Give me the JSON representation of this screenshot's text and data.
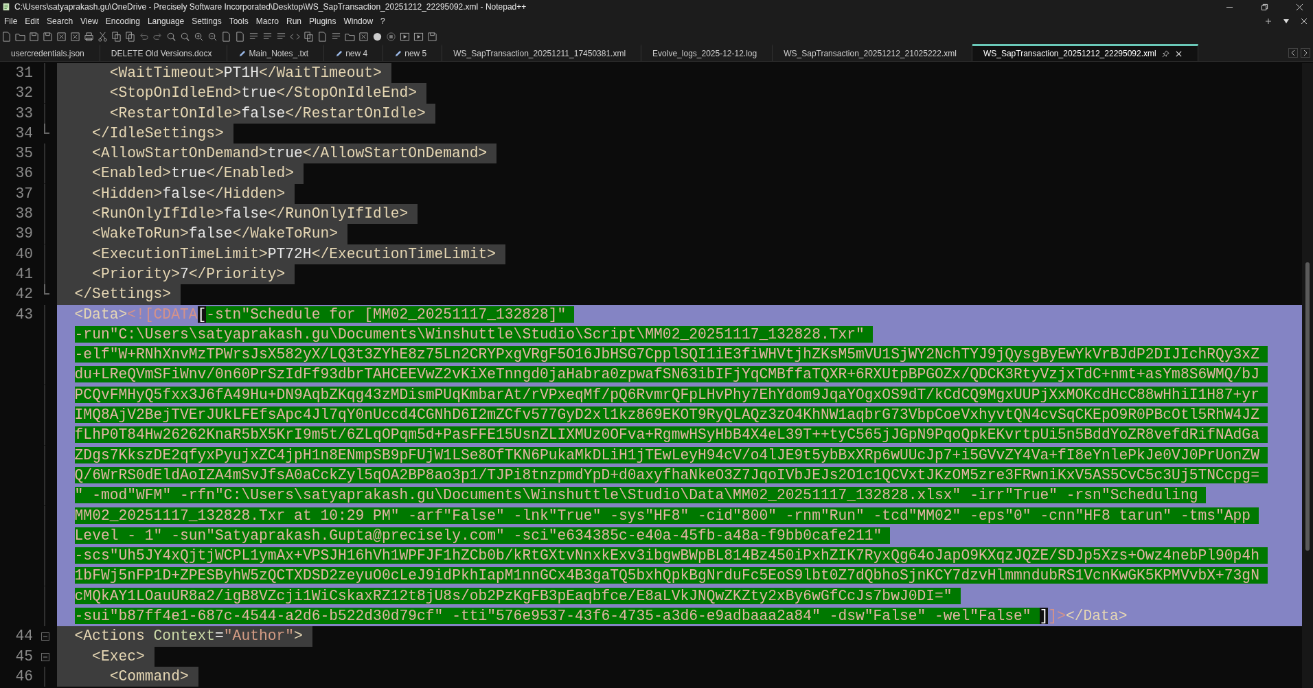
{
  "window": {
    "title": "C:\\Users\\satyaprakash.gu\\OneDrive - Precisely Software Incorporated\\Desktop\\WS_SapTransaction_20251212_22295092.xml - Notepad++"
  },
  "menu": [
    "File",
    "Edit",
    "Search",
    "View",
    "Encoding",
    "Language",
    "Settings",
    "Tools",
    "Macro",
    "Run",
    "Plugins",
    "Window",
    "?"
  ],
  "tabs": [
    {
      "label": "usercredentials.json",
      "modified": false,
      "selected": false
    },
    {
      "label": "DELETE Old Versions.docx",
      "modified": false,
      "selected": false
    },
    {
      "label": "Main_Notes_.txt",
      "modified": true,
      "selected": false
    },
    {
      "label": "new 4",
      "modified": true,
      "selected": false
    },
    {
      "label": "new 5",
      "modified": true,
      "selected": false
    },
    {
      "label": "WS_SapTransaction_20251211_17450381.xml",
      "modified": false,
      "selected": false
    },
    {
      "label": "Evolve_logs_2025-12-12.log",
      "modified": false,
      "selected": false
    },
    {
      "label": "WS_SapTransaction_20251212_21025222.xml",
      "modified": false,
      "selected": false
    },
    {
      "label": "WS_SapTransaction_20251212_22295092.xml",
      "modified": false,
      "selected": true
    }
  ],
  "editor": {
    "lines": [
      {
        "number": "31",
        "fold_open": false,
        "fold_end": false,
        "selected": false,
        "tokens": [
          {
            "kind": "tag",
            "text": "      <WaitTimeout>"
          },
          {
            "kind": "text",
            "text": "PT1H"
          },
          {
            "kind": "tag",
            "text": "</WaitTimeout>"
          }
        ]
      },
      {
        "number": "32",
        "fold_open": false,
        "fold_end": false,
        "selected": false,
        "tokens": [
          {
            "kind": "tag",
            "text": "      <StopOnIdleEnd>"
          },
          {
            "kind": "text",
            "text": "true"
          },
          {
            "kind": "tag",
            "text": "</StopOnIdleEnd>"
          }
        ]
      },
      {
        "number": "33",
        "fold_open": false,
        "fold_end": false,
        "selected": false,
        "tokens": [
          {
            "kind": "tag",
            "text": "      <RestartOnIdle>"
          },
          {
            "kind": "text",
            "text": "false"
          },
          {
            "kind": "tag",
            "text": "</RestartOnIdle>"
          }
        ]
      },
      {
        "number": "34",
        "fold_open": false,
        "fold_end": true,
        "selected": false,
        "tokens": [
          {
            "kind": "tag",
            "text": "    </IdleSettings>"
          }
        ]
      },
      {
        "number": "35",
        "fold_open": false,
        "fold_end": false,
        "selected": false,
        "tokens": [
          {
            "kind": "tag",
            "text": "    <AllowStartOnDemand>"
          },
          {
            "kind": "text",
            "text": "true"
          },
          {
            "kind": "tag",
            "text": "</AllowStartOnDemand>"
          }
        ]
      },
      {
        "number": "36",
        "fold_open": false,
        "fold_end": false,
        "selected": false,
        "tokens": [
          {
            "kind": "tag",
            "text": "    <Enabled>"
          },
          {
            "kind": "text",
            "text": "true"
          },
          {
            "kind": "tag",
            "text": "</Enabled>"
          }
        ]
      },
      {
        "number": "37",
        "fold_open": false,
        "fold_end": false,
        "selected": false,
        "tokens": [
          {
            "kind": "tag",
            "text": "    <Hidden>"
          },
          {
            "kind": "text",
            "text": "false"
          },
          {
            "kind": "tag",
            "text": "</Hidden>"
          }
        ]
      },
      {
        "number": "38",
        "fold_open": false,
        "fold_end": false,
        "selected": false,
        "tokens": [
          {
            "kind": "tag",
            "text": "    <RunOnlyIfIdle>"
          },
          {
            "kind": "text",
            "text": "false"
          },
          {
            "kind": "tag",
            "text": "</RunOnlyIfIdle>"
          }
        ]
      },
      {
        "number": "39",
        "fold_open": false,
        "fold_end": false,
        "selected": false,
        "tokens": [
          {
            "kind": "tag",
            "text": "    <WakeToRun>"
          },
          {
            "kind": "text",
            "text": "false"
          },
          {
            "kind": "tag",
            "text": "</WakeToRun>"
          }
        ]
      },
      {
        "number": "40",
        "fold_open": false,
        "fold_end": false,
        "selected": false,
        "tokens": [
          {
            "kind": "tag",
            "text": "    <ExecutionTimeLimit>"
          },
          {
            "kind": "text",
            "text": "PT72H"
          },
          {
            "kind": "tag",
            "text": "</ExecutionTimeLimit>"
          }
        ]
      },
      {
        "number": "41",
        "fold_open": false,
        "fold_end": false,
        "selected": false,
        "tokens": [
          {
            "kind": "tag",
            "text": "    <Priority>"
          },
          {
            "kind": "text",
            "text": "7"
          },
          {
            "kind": "tag",
            "text": "</Priority>"
          }
        ]
      },
      {
        "number": "42",
        "fold_open": false,
        "fold_end": true,
        "selected": false,
        "tokens": [
          {
            "kind": "tag",
            "text": "  </Settings>"
          }
        ]
      },
      {
        "number": "43",
        "fold_open": false,
        "fold_end": false,
        "selected": true,
        "tokens": [
          {
            "kind": "tag",
            "text": "  <Data>"
          },
          {
            "kind": "cdata",
            "text": "<![CDATA"
          },
          {
            "kind": "brace",
            "text": "["
          },
          {
            "kind": "match",
            "text": "-stn\"Schedule for [MM02_20251117_132828]\""
          },
          {
            "kind": "wrap"
          },
          {
            "kind": "match",
            "text": "-run\"C:\\Users\\satyaprakash.gu\\Documents\\Winshuttle\\Studio\\Script\\MM02_20251117_132828.Txr\""
          },
          {
            "kind": "wrap"
          },
          {
            "kind": "match",
            "text": "-elf\"W+RNhXnvMzTPWrsJsX582yX/LQ3t3ZYhE8z75Ln2CRYPxgVRgF5O16JbHSG7CpplSQI1iE3fiWHVtjhZKsM5mVU1SjWY2NchTYJ9jQysgByEwYkVrBJdP2DIJIchRQy3xZ"
          },
          {
            "kind": "wrap"
          },
          {
            "kind": "match",
            "text": "du+LReQVmSFiWnv/0n60PrSzIdFf93dbrTAHCEEVwZ2vKiXeTnngd0jaHabra0zpwafSN63ibIFjYqCMBffaTQXR+6RXUtpBPGOZx/QDCK3RtyVzjxTdC+nmt+asYm8S6WMQ/bJ"
          },
          {
            "kind": "wrap"
          },
          {
            "kind": "match",
            "text": "PCQvFMHyQ5fxx3J6fA49Hu+DN9AqbZKqg43zMDismPUqKmbarAt/rVPxeqMf/pQ6RvmrQFpLHvPhy7EhYdom9JqaYOgxOS9dT/kCdCQ9MgxUUPjXxMOKcdHcC88wHhiI1H87+yr"
          },
          {
            "kind": "wrap"
          },
          {
            "kind": "match",
            "text": "IMQ8AjV2BejTVErJUkLFEfsApc4Jl7qY0nUccd4CGNhD6I2mZCfv577GyD2xl1kz869EKOT9RyQLAQz3zO4KhNW1aqbrG73VbpCoeVxhyvtQN4cvSqCKEpO9R0PBcOtl5RhW4JZ"
          },
          {
            "kind": "wrap"
          },
          {
            "kind": "match",
            "text": "fLhP0T84Hw26262KnaR5bX5KrI9m5t/6ZLqOPqm5d+PasFFE15UsnZLIXMUz0OFva+RgmwHSyHbB4X4eL39T++tyC565jJGpN9PqoQpkEKvrtpUi5n5BddYoZR8vefdRifNAdGa"
          },
          {
            "kind": "wrap"
          },
          {
            "kind": "match",
            "text": "ZDgs7KkszDE2qfyxPyujxZC4jpH1n8ENmpSB9pFUjW1LSe8OfTKN6PukaMkDLiH1jTEwLeyH94cV/o4lJE9t5ybBxXRp6wUUcJp7+i5GVvZY4Va+fI8eYnlePkJe0VJ0PrUonZW"
          },
          {
            "kind": "wrap"
          },
          {
            "kind": "match",
            "text": "Q/6WrRS0dEldAoIZA4mSvJfsA0aCckZyl5qOA2BP8ao3p1/TJPi8tnzpmdYpD+d0axyfhaNkeO3Z7JqoIVbJEJs2O1c1QCVxtJKzOM5zre3FRwniKxV5AS5CvC5c3Uj5TNCcpg="
          },
          {
            "kind": "wrap"
          },
          {
            "kind": "match",
            "text": "\" -mod\"WFM\" -rfn\"C:\\Users\\satyaprakash.gu\\Documents\\Winshuttle\\Studio\\Data\\MM02_20251117_132828.xlsx\" -irr\"True\" -rsn\"Scheduling"
          },
          {
            "kind": "wrap"
          },
          {
            "kind": "match",
            "text": "MM02_20251117_132828.Txr at 10:29 PM\" -arf\"False\" -lnk\"True\" -sys\"HF8\" -cid\"800\" -rnm\"Run\" -tcd\"MM02\" -eps\"0\" -cnn\"HF8 tarun\" -tms\"App"
          },
          {
            "kind": "wrap"
          },
          {
            "kind": "match",
            "text": "Level - 1\" -sun\"Satyaprakash.Gupta@precisely.com\" -sci\"e634385c-e40a-45fb-a48a-f9bb0cafe211\""
          },
          {
            "kind": "wrap"
          },
          {
            "kind": "match",
            "text": "-scs\"Uh5JY4xQjtjWCPL1ymAx+VPSJH16hVh1WPFJF1hZCb0b/kRtGXtvNnxkExv3ibgwBWpBL814Bz450iPxhZIK7RyxQg64oJapO9KXqzJQZE/SDJp5Xzs+Owz4nebPl90p4h"
          },
          {
            "kind": "wrap"
          },
          {
            "kind": "match",
            "text": "1bFWj5nFP1D+ZPESByhW5zQCTXDSD2zeyuO0cLeJ9idPkhIapM1nnGCx4B3gaTQ5bxhQpkBgNrduFc5EoS9lbt0Z7dQbhoSjnKCY7dzvHlmmndubRS1VcnKwGK5KPMVvbX+73gN"
          },
          {
            "kind": "wrap"
          },
          {
            "kind": "match",
            "text": "cMQkAY1LOauUR8a2/igB8VZcji1WiCskaxRZ12t8jU8s/ob2PzKgFB3pEaqbfce/E8aLVkJNQwZKZty2xBy6wGfCcJs7bwJ0DI=\""
          },
          {
            "kind": "wrap"
          },
          {
            "kind": "match",
            "text": "-sui\"b87ff4e1-687c-4544-a2d6-b522d30d79cf\" -tti\"576e9537-43f6-4735-a3d6-e9adbaaa2a84\" -dsw\"False\" -wel\"False\""
          },
          {
            "kind": "brace",
            "text": "]"
          },
          {
            "kind": "cdata",
            "text": "]>"
          },
          {
            "kind": "tag",
            "text": "</Data>"
          }
        ]
      },
      {
        "number": "44",
        "fold_open": true,
        "fold_end": false,
        "selected": false,
        "tokens": [
          {
            "kind": "tag",
            "text": "  <Actions "
          },
          {
            "kind": "attr",
            "text": "Context"
          },
          {
            "kind": "op",
            "text": "="
          },
          {
            "kind": "string",
            "text": "\"Author\""
          },
          {
            "kind": "tag",
            "text": ">"
          }
        ]
      },
      {
        "number": "45",
        "fold_open": true,
        "fold_end": false,
        "selected": false,
        "tokens": [
          {
            "kind": "tag",
            "text": "    <Exec>"
          }
        ]
      },
      {
        "number": "46",
        "fold_open": false,
        "fold_end": false,
        "selected": false,
        "tokens": [
          {
            "kind": "tag",
            "text": "      <Command>"
          }
        ]
      }
    ]
  }
}
